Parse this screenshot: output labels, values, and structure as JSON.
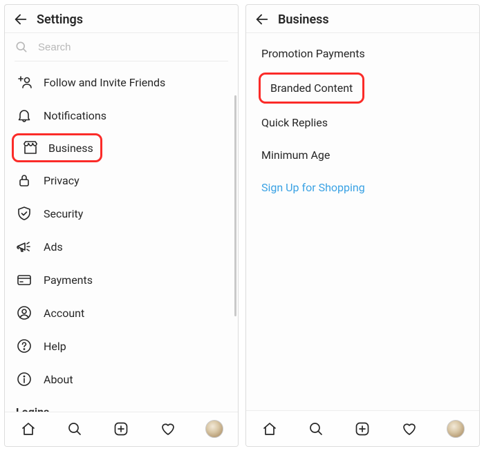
{
  "left": {
    "header": {
      "title": "Settings"
    },
    "search": {
      "placeholder": "Search"
    },
    "menu": {
      "follow_invite": "Follow and Invite Friends",
      "notifications": "Notifications",
      "business": "Business",
      "privacy": "Privacy",
      "security": "Security",
      "ads": "Ads",
      "payments": "Payments",
      "account": "Account",
      "help": "Help",
      "about": "About"
    },
    "section_logins": "Logins"
  },
  "right": {
    "header": {
      "title": "Business"
    },
    "items": {
      "promotion_payments": "Promotion Payments",
      "branded_content": "Branded Content",
      "quick_replies": "Quick Replies",
      "minimum_age": "Minimum Age",
      "signup_shopping": "Sign Up for Shopping"
    }
  }
}
